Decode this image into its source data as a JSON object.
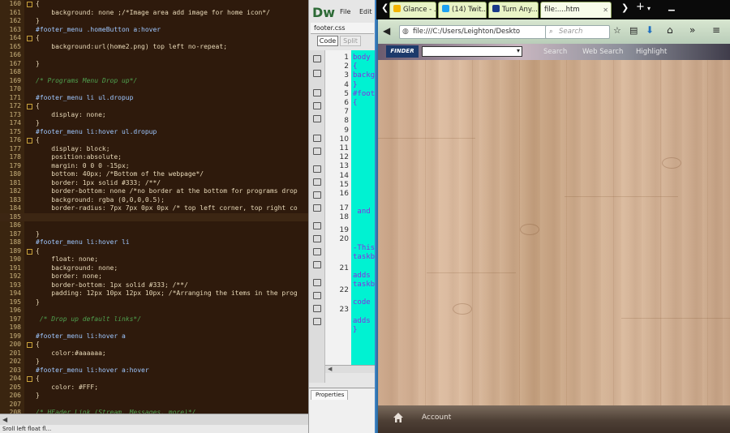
{
  "editor": {
    "lines": [
      {
        "n": "160",
        "fold": true,
        "t": "{"
      },
      {
        "n": "161",
        "fold": false,
        "t": "    background: none ;/*Image area add image for home icon*/"
      },
      {
        "n": "162",
        "fold": false,
        "t": "}"
      },
      {
        "n": "163",
        "fold": false,
        "t": "#footer_menu .homeButton a:hover"
      },
      {
        "n": "164",
        "fold": true,
        "t": "{"
      },
      {
        "n": "165",
        "fold": false,
        "t": "    background:url(home2.png) top left no-repeat;"
      },
      {
        "n": "166",
        "fold": false,
        "t": ""
      },
      {
        "n": "167",
        "fold": false,
        "t": "}"
      },
      {
        "n": "168",
        "fold": false,
        "t": ""
      },
      {
        "n": "169",
        "fold": false,
        "t": "/* Programs Menu Drop up*/"
      },
      {
        "n": "170",
        "fold": false,
        "t": ""
      },
      {
        "n": "171",
        "fold": false,
        "t": "#footer_menu li ul.dropup"
      },
      {
        "n": "172",
        "fold": true,
        "t": "{"
      },
      {
        "n": "173",
        "fold": false,
        "t": "    display: none;"
      },
      {
        "n": "174",
        "fold": false,
        "t": "}"
      },
      {
        "n": "175",
        "fold": false,
        "t": "#footer_menu li:hover ul.dropup"
      },
      {
        "n": "176",
        "fold": true,
        "t": "{"
      },
      {
        "n": "177",
        "fold": false,
        "t": "    display: block;"
      },
      {
        "n": "178",
        "fold": false,
        "t": "    position:absolute;"
      },
      {
        "n": "179",
        "fold": false,
        "t": "    margin: 0 0 0 -15px;"
      },
      {
        "n": "180",
        "fold": false,
        "t": "    bottom: 40px; /*Bottom of the webpage*/"
      },
      {
        "n": "181",
        "fold": false,
        "t": "    border: 1px solid #333; /**/"
      },
      {
        "n": "182",
        "fold": false,
        "t": "    border-bottom: none /*no border at the bottom for programs drop"
      },
      {
        "n": "183",
        "fold": false,
        "t": "    background: rgba (0,0,0,0.5);"
      },
      {
        "n": "184",
        "fold": false,
        "t": "    border-radius: 7px 7px 0px 0px /* top left corner, top right co"
      },
      {
        "n": "185",
        "fold": false,
        "t": ""
      },
      {
        "n": "186",
        "fold": false,
        "t": ""
      },
      {
        "n": "187",
        "fold": false,
        "t": "}"
      },
      {
        "n": "188",
        "fold": false,
        "t": "#footer_menu li:hover li"
      },
      {
        "n": "189",
        "fold": true,
        "t": "{"
      },
      {
        "n": "190",
        "fold": false,
        "t": "    float: none;"
      },
      {
        "n": "191",
        "fold": false,
        "t": "    background: none;"
      },
      {
        "n": "192",
        "fold": false,
        "t": "    border: none;"
      },
      {
        "n": "193",
        "fold": false,
        "t": "    border-bottom: 1px solid #333; /**/"
      },
      {
        "n": "194",
        "fold": false,
        "t": "    padding: 12px 10px 12px 10px; /*Arranging the items in the prog"
      },
      {
        "n": "195",
        "fold": false,
        "t": "}"
      },
      {
        "n": "196",
        "fold": false,
        "t": ""
      },
      {
        "n": "197",
        "fold": false,
        "t": " /* Drop up default links*/"
      },
      {
        "n": "198",
        "fold": false,
        "t": ""
      },
      {
        "n": "199",
        "fold": false,
        "t": "#footer_menu li:hover a"
      },
      {
        "n": "200",
        "fold": true,
        "t": "{"
      },
      {
        "n": "201",
        "fold": false,
        "t": "    color:#aaaaaa;"
      },
      {
        "n": "202",
        "fold": false,
        "t": "}"
      },
      {
        "n": "203",
        "fold": false,
        "t": "#footer_menu li:hover a:hover"
      },
      {
        "n": "204",
        "fold": true,
        "t": "{"
      },
      {
        "n": "205",
        "fold": false,
        "t": "    color: #FFF;"
      },
      {
        "n": "206",
        "fold": false,
        "t": "}"
      },
      {
        "n": "207",
        "fold": false,
        "t": ""
      },
      {
        "n": "208",
        "fold": false,
        "t": "/* HEader Link (Stream, Messages, more)*/"
      }
    ],
    "status_text": "Sroll left float fl..."
  },
  "dreamweaver": {
    "logo": "Dw",
    "menu": [
      "File",
      "Edit"
    ],
    "file_tab": "footer.css",
    "code_button": "Code",
    "split_button": "Split",
    "line_numbers": [
      "1",
      "2",
      "3",
      "4",
      "5",
      "6",
      "7",
      "8",
      "9",
      "10",
      "11",
      "12",
      "13",
      "14",
      "15",
      "16",
      "17",
      "18",
      "19",
      "20",
      "21",
      "22",
      "23"
    ],
    "code_snippets": [
      {
        "row": 0,
        "t": "body"
      },
      {
        "row": 1,
        "t": "{"
      },
      {
        "row": 2,
        "t": "backg"
      },
      {
        "row": 3,
        "t": "}"
      },
      {
        "row": 4,
        "t": "#foot"
      },
      {
        "row": 5,
        "t": "{"
      },
      {
        "row": 17,
        "t": " and"
      },
      {
        "row": 21,
        "t": "-This"
      },
      {
        "row": 22,
        "t": "taskb"
      },
      {
        "row": 24,
        "t": "adds"
      },
      {
        "row": 25,
        "t": "taskb"
      },
      {
        "row": 27,
        "t": "code"
      },
      {
        "row": 29,
        "t": "adds"
      },
      {
        "row": 30,
        "t": "}"
      }
    ],
    "properties_tab": "Properties"
  },
  "browser": {
    "tabs": [
      {
        "label": "Glance - ...",
        "icon_color": "#f4b400"
      },
      {
        "label": "(14) Twit...",
        "icon_color": "#1da1f2"
      },
      {
        "label": "Turn Any...",
        "icon_color": "#1a3a8a"
      },
      {
        "label": "file:....htm",
        "icon_color": ""
      }
    ],
    "url": "file:///C:/Users/Leighton/Deskto",
    "search_placeholder": "Search",
    "toolbar_logo": "FINDER",
    "toolbar_items": [
      "Search",
      "Web Search",
      "Highlight"
    ],
    "footer": {
      "account_label": "Account"
    },
    "colors": {
      "tab_bg": "#e9f4c6",
      "content_wood": "#d0ae91",
      "footer_bg": "#4e4036"
    }
  }
}
